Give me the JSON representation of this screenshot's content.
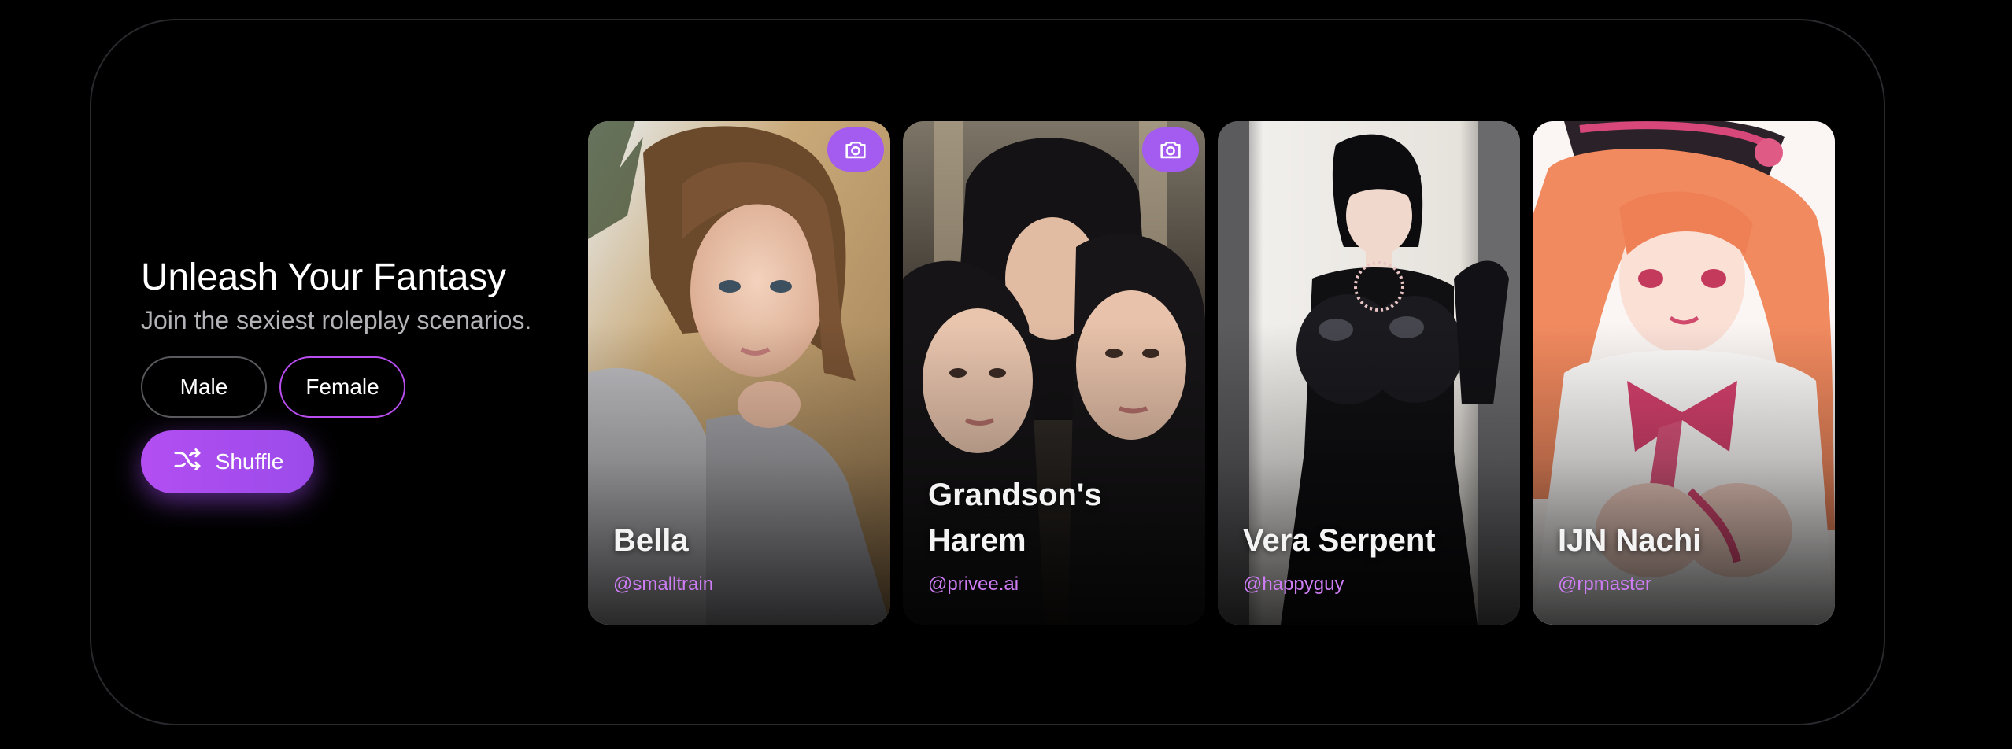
{
  "hero": {
    "title": "Unleash Your Fantasy",
    "subtitle": "Join the sexiest roleplay scenarios.",
    "gender_options": [
      "Male",
      "Female"
    ],
    "shuffle_label": "Shuffle",
    "shuffle_icon": "shuffle-icon"
  },
  "cards": [
    {
      "name": "Bella",
      "author": "@smalltrain",
      "has_photo_badge": true
    },
    {
      "name": "Grandson's Harem",
      "author": "@privee.ai",
      "has_photo_badge": true
    },
    {
      "name": "Vera Serpent",
      "author": "@happyguy",
      "has_photo_badge": false
    },
    {
      "name": "IJN Nachi",
      "author": "@rpmaster",
      "has_photo_badge": false
    }
  ],
  "colors": {
    "background": "#000000",
    "accent": "#a34df0",
    "author_text": "#cf7df5",
    "panel_border": "#2a2a2e"
  }
}
